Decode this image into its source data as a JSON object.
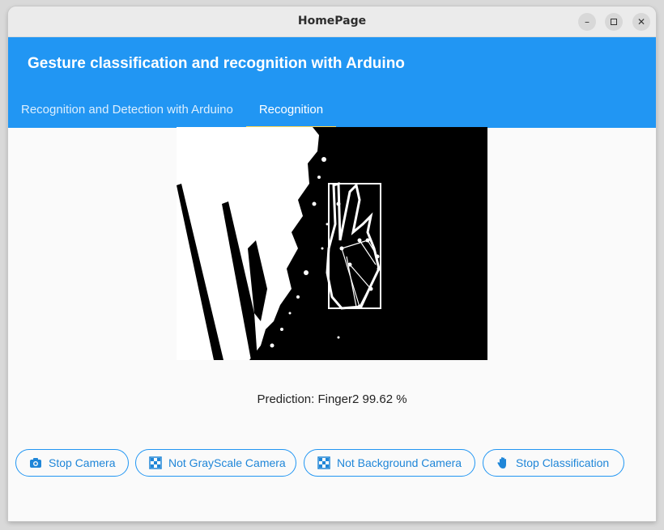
{
  "window": {
    "title": "HomePage"
  },
  "header": {
    "title": "Gesture classification and recognition with Arduino"
  },
  "tabs": [
    {
      "label": "Recognition and Detection with Arduino"
    },
    {
      "label": "Recognition"
    }
  ],
  "camera": {
    "prediction": "Prediction: Finger2 99.62 %"
  },
  "buttons": {
    "stop_camera": "Stop Camera",
    "not_grayscale": "Not GrayScale Camera",
    "not_background": "Not Background Camera",
    "stop_classification": "Stop Classification"
  },
  "colors": {
    "accent": "#2196f3",
    "tab_indicator": "#ffd54f"
  }
}
